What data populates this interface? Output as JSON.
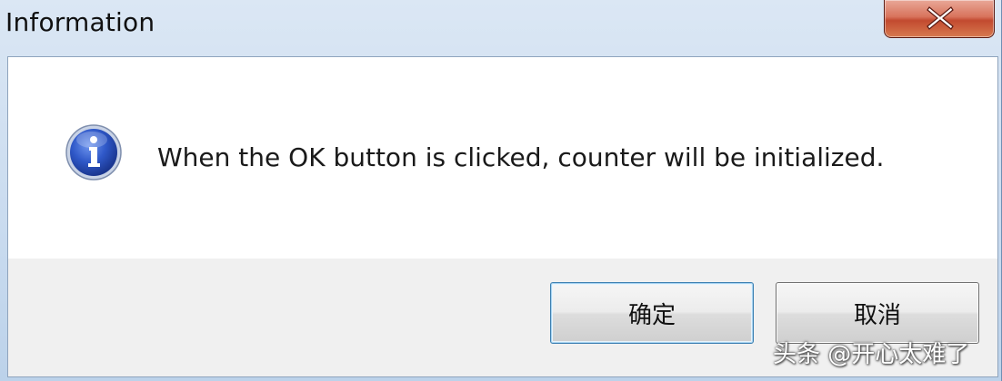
{
  "window": {
    "title": "Information",
    "close_icon": "close-x-icon"
  },
  "dialog": {
    "icon": "info-icon",
    "message": "When the OK button is clicked, counter will be initialized."
  },
  "buttons": {
    "ok_label": "确定",
    "cancel_label": "取消"
  },
  "watermark": {
    "text": "头条 @开心太难了"
  },
  "colors": {
    "titlebar": "#c9dbef",
    "close_button": "#c24a2f",
    "info_icon": "#2a4fb8",
    "button_bar": "#f0f0f0"
  }
}
